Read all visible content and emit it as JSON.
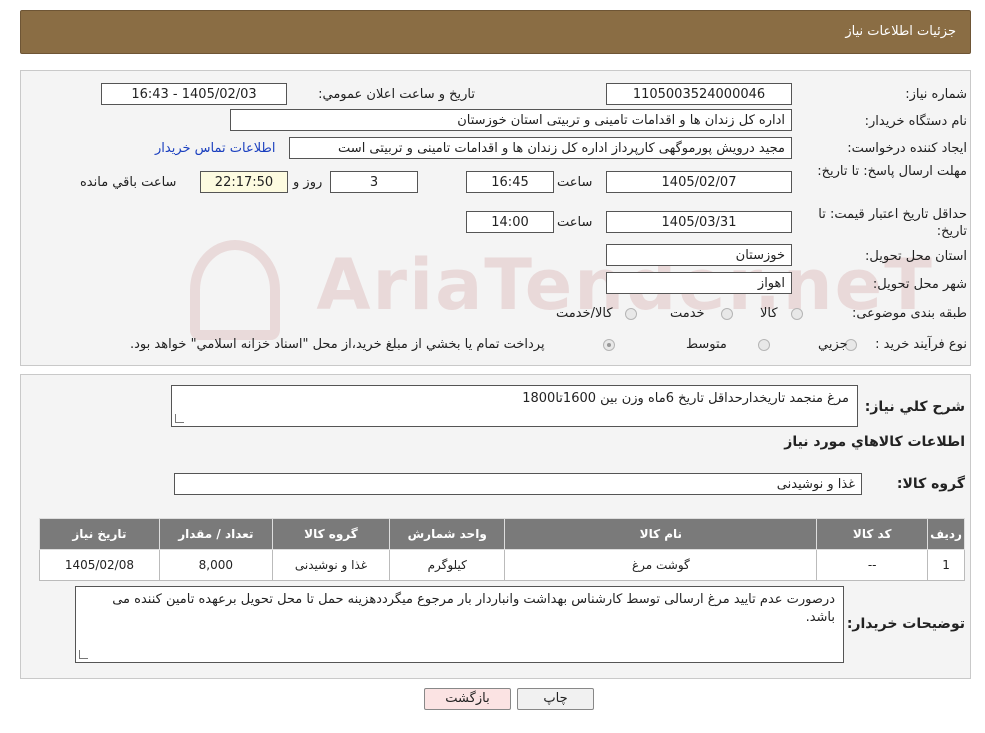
{
  "header": {
    "title": "جزئیات اطلاعات نیاز"
  },
  "watermark": {
    "text": "AriaTender.neT"
  },
  "fields": {
    "need_number_label": "شماره نیاز:",
    "need_number": "1105003524000046",
    "announce_label": "تاریخ و ساعت اعلان عمومي:",
    "announce_value": "1405/02/03 - 16:43",
    "buyer_label": "نام دستگاه خريدار:",
    "buyer_value": "اداره کل زندان ها و اقدامات تامینی و تربیتی استان خوزستان",
    "creator_label": "ايجاد کننده درخواست:",
    "creator_value": "مجید درویش پورموگهی کارپرداز اداره کل زندان ها و اقدامات تامینی و تربیتی است",
    "contact_link": "اطلاعات تماس خريدار",
    "deadline_label": "مهلت ارسال پاسخ: تا تاریخ:",
    "deadline_date": "1405/02/07",
    "time_label": "ساعت",
    "deadline_time": "16:45",
    "days_value": "3",
    "days_label": "روز و",
    "remaining_time": "22:17:50",
    "remaining_label": "ساعت باقي مانده",
    "validity_label": "حداقل تاريخ اعتبار قيمت: تا تاريخ:",
    "validity_date": "1405/03/31",
    "validity_time": "14:00",
    "province_label": "استان محل تحويل:",
    "province_value": "خوزستان",
    "city_label": "شهر محل تحويل:",
    "city_value": "اهواز",
    "category_label": "طبقه بندی موضوعی:",
    "category_options": [
      "کالا",
      "خدمت",
      "کالا/خدمت"
    ],
    "process_label": "نوع فرآيند خريد :",
    "process_options": [
      "جزيي",
      "متوسط"
    ],
    "process_note": "پرداخت تمام يا بخشي از مبلغ خريد،از محل \"اسناد خزانه اسلامي\" خواهد بود."
  },
  "details": {
    "summary_label": "شرح کلي نياز:",
    "summary_value": "مرغ منجمد تاریخدارحداقل تاریخ 6ماه وزن بین 1600تا1800",
    "goods_info_title": "اطلاعات کالاهاي مورد نياز",
    "group_label": "گروه کالا:",
    "group_value": "غذا و نوشیدنی",
    "table": {
      "headers": [
        "رديف",
        "کد کالا",
        "نام کالا",
        "واحد شمارش",
        "گروه کالا",
        "تعداد / مقدار",
        "تاريخ نياز"
      ],
      "rows": [
        [
          "1",
          "--",
          "گوشت مرغ",
          "کیلوگرم",
          "غذا و نوشیدنی",
          "8,000",
          "1405/02/08"
        ]
      ]
    },
    "buyer_notes_label": "توضيحات خريدار:",
    "buyer_notes_value": "درصورت عدم تایید مرغ ارسالی توسط کارشناس بهداشت وانباردار بار مرجوع میگرددهزینه حمل تا محل تحویل برعهده تامین کننده می باشد."
  },
  "buttons": {
    "print": "چاپ",
    "back": "بازگشت"
  },
  "colors": {
    "header": "#8a6d44",
    "back_button": "#fbe3e3",
    "table_header": "#7a7a7a",
    "link": "#1a3fbf"
  }
}
